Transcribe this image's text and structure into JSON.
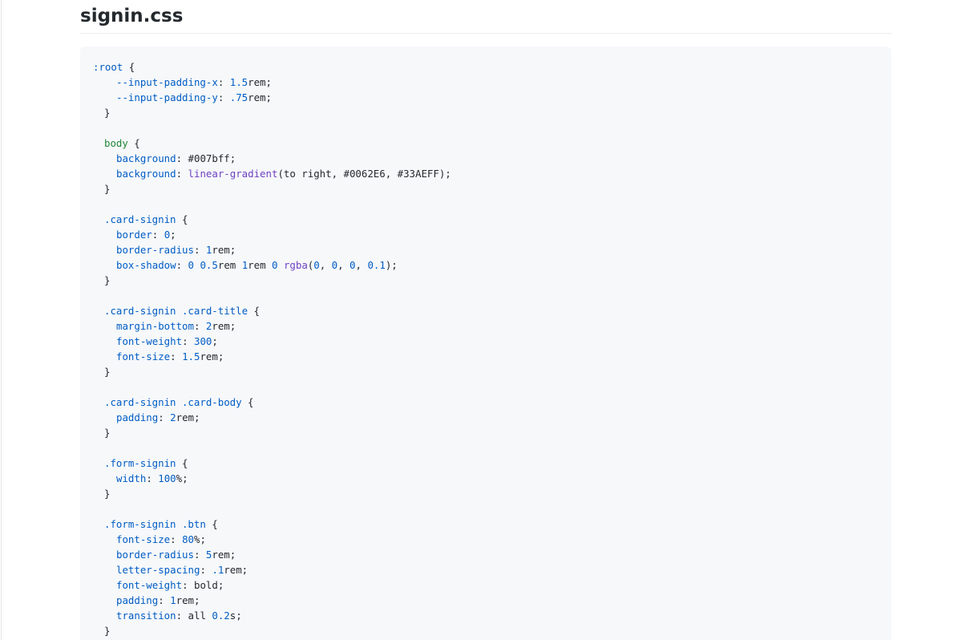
{
  "file": {
    "title": "signin.css"
  },
  "code_lines": [
    {
      "indent": 0,
      "tokens": [
        {
          "t": ":root",
          "c": "cls"
        },
        {
          "t": " {",
          "c": "plain"
        }
      ]
    },
    {
      "indent": 4,
      "tokens": [
        {
          "t": "--input-padding-x",
          "c": "prop"
        },
        {
          "t": ": ",
          "c": "plain"
        },
        {
          "t": "1.5",
          "c": "num"
        },
        {
          "t": "rem;",
          "c": "plain"
        }
      ]
    },
    {
      "indent": 4,
      "tokens": [
        {
          "t": "--input-padding-y",
          "c": "prop"
        },
        {
          "t": ": ",
          "c": "plain"
        },
        {
          "t": ".75",
          "c": "num"
        },
        {
          "t": "rem;",
          "c": "plain"
        }
      ]
    },
    {
      "indent": 2,
      "tokens": [
        {
          "t": "}",
          "c": "plain"
        }
      ]
    },
    {
      "indent": 0,
      "tokens": []
    },
    {
      "indent": 2,
      "tokens": [
        {
          "t": "body",
          "c": "sel"
        },
        {
          "t": " {",
          "c": "plain"
        }
      ]
    },
    {
      "indent": 4,
      "tokens": [
        {
          "t": "background",
          "c": "prop"
        },
        {
          "t": ": #007bff;",
          "c": "plain"
        }
      ]
    },
    {
      "indent": 4,
      "tokens": [
        {
          "t": "background",
          "c": "prop"
        },
        {
          "t": ": ",
          "c": "plain"
        },
        {
          "t": "linear-gradient",
          "c": "fn"
        },
        {
          "t": "(to right, #0062E6, #33AEFF);",
          "c": "plain"
        }
      ]
    },
    {
      "indent": 2,
      "tokens": [
        {
          "t": "}",
          "c": "plain"
        }
      ]
    },
    {
      "indent": 0,
      "tokens": []
    },
    {
      "indent": 2,
      "tokens": [
        {
          "t": ".card-signin",
          "c": "cls"
        },
        {
          "t": " {",
          "c": "plain"
        }
      ]
    },
    {
      "indent": 4,
      "tokens": [
        {
          "t": "border",
          "c": "prop"
        },
        {
          "t": ": ",
          "c": "plain"
        },
        {
          "t": "0",
          "c": "num"
        },
        {
          "t": ";",
          "c": "plain"
        }
      ]
    },
    {
      "indent": 4,
      "tokens": [
        {
          "t": "border-radius",
          "c": "prop"
        },
        {
          "t": ": ",
          "c": "plain"
        },
        {
          "t": "1",
          "c": "num"
        },
        {
          "t": "rem;",
          "c": "plain"
        }
      ]
    },
    {
      "indent": 4,
      "tokens": [
        {
          "t": "box-shadow",
          "c": "prop"
        },
        {
          "t": ": ",
          "c": "plain"
        },
        {
          "t": "0",
          "c": "num"
        },
        {
          "t": " ",
          "c": "plain"
        },
        {
          "t": "0.5",
          "c": "num"
        },
        {
          "t": "rem ",
          "c": "plain"
        },
        {
          "t": "1",
          "c": "num"
        },
        {
          "t": "rem ",
          "c": "plain"
        },
        {
          "t": "0",
          "c": "num"
        },
        {
          "t": " ",
          "c": "plain"
        },
        {
          "t": "rgba",
          "c": "fn"
        },
        {
          "t": "(",
          "c": "plain"
        },
        {
          "t": "0",
          "c": "num"
        },
        {
          "t": ", ",
          "c": "plain"
        },
        {
          "t": "0",
          "c": "num"
        },
        {
          "t": ", ",
          "c": "plain"
        },
        {
          "t": "0",
          "c": "num"
        },
        {
          "t": ", ",
          "c": "plain"
        },
        {
          "t": "0.1",
          "c": "num"
        },
        {
          "t": ");",
          "c": "plain"
        }
      ]
    },
    {
      "indent": 2,
      "tokens": [
        {
          "t": "}",
          "c": "plain"
        }
      ]
    },
    {
      "indent": 0,
      "tokens": []
    },
    {
      "indent": 2,
      "tokens": [
        {
          "t": ".card-signin .card-title",
          "c": "cls"
        },
        {
          "t": " {",
          "c": "plain"
        }
      ]
    },
    {
      "indent": 4,
      "tokens": [
        {
          "t": "margin-bottom",
          "c": "prop"
        },
        {
          "t": ": ",
          "c": "plain"
        },
        {
          "t": "2",
          "c": "num"
        },
        {
          "t": "rem;",
          "c": "plain"
        }
      ]
    },
    {
      "indent": 4,
      "tokens": [
        {
          "t": "font-weight",
          "c": "prop"
        },
        {
          "t": ": ",
          "c": "plain"
        },
        {
          "t": "300",
          "c": "num"
        },
        {
          "t": ";",
          "c": "plain"
        }
      ]
    },
    {
      "indent": 4,
      "tokens": [
        {
          "t": "font-size",
          "c": "prop"
        },
        {
          "t": ": ",
          "c": "plain"
        },
        {
          "t": "1.5",
          "c": "num"
        },
        {
          "t": "rem;",
          "c": "plain"
        }
      ]
    },
    {
      "indent": 2,
      "tokens": [
        {
          "t": "}",
          "c": "plain"
        }
      ]
    },
    {
      "indent": 0,
      "tokens": []
    },
    {
      "indent": 2,
      "tokens": [
        {
          "t": ".card-signin .card-body",
          "c": "cls"
        },
        {
          "t": " {",
          "c": "plain"
        }
      ]
    },
    {
      "indent": 4,
      "tokens": [
        {
          "t": "padding",
          "c": "prop"
        },
        {
          "t": ": ",
          "c": "plain"
        },
        {
          "t": "2",
          "c": "num"
        },
        {
          "t": "rem;",
          "c": "plain"
        }
      ]
    },
    {
      "indent": 2,
      "tokens": [
        {
          "t": "}",
          "c": "plain"
        }
      ]
    },
    {
      "indent": 0,
      "tokens": []
    },
    {
      "indent": 2,
      "tokens": [
        {
          "t": ".form-signin",
          "c": "cls"
        },
        {
          "t": " {",
          "c": "plain"
        }
      ]
    },
    {
      "indent": 4,
      "tokens": [
        {
          "t": "width",
          "c": "prop"
        },
        {
          "t": ": ",
          "c": "plain"
        },
        {
          "t": "100",
          "c": "num"
        },
        {
          "t": "%;",
          "c": "plain"
        }
      ]
    },
    {
      "indent": 2,
      "tokens": [
        {
          "t": "}",
          "c": "plain"
        }
      ]
    },
    {
      "indent": 0,
      "tokens": []
    },
    {
      "indent": 2,
      "tokens": [
        {
          "t": ".form-signin .btn",
          "c": "cls"
        },
        {
          "t": " {",
          "c": "plain"
        }
      ]
    },
    {
      "indent": 4,
      "tokens": [
        {
          "t": "font-size",
          "c": "prop"
        },
        {
          "t": ": ",
          "c": "plain"
        },
        {
          "t": "80",
          "c": "num"
        },
        {
          "t": "%;",
          "c": "plain"
        }
      ]
    },
    {
      "indent": 4,
      "tokens": [
        {
          "t": "border-radius",
          "c": "prop"
        },
        {
          "t": ": ",
          "c": "plain"
        },
        {
          "t": "5",
          "c": "num"
        },
        {
          "t": "rem;",
          "c": "plain"
        }
      ]
    },
    {
      "indent": 4,
      "tokens": [
        {
          "t": "letter-spacing",
          "c": "prop"
        },
        {
          "t": ": ",
          "c": "plain"
        },
        {
          "t": ".1",
          "c": "num"
        },
        {
          "t": "rem;",
          "c": "plain"
        }
      ]
    },
    {
      "indent": 4,
      "tokens": [
        {
          "t": "font-weight",
          "c": "prop"
        },
        {
          "t": ": bold;",
          "c": "plain"
        }
      ]
    },
    {
      "indent": 4,
      "tokens": [
        {
          "t": "padding",
          "c": "prop"
        },
        {
          "t": ": ",
          "c": "plain"
        },
        {
          "t": "1",
          "c": "num"
        },
        {
          "t": "rem;",
          "c": "plain"
        }
      ]
    },
    {
      "indent": 4,
      "tokens": [
        {
          "t": "transition",
          "c": "prop"
        },
        {
          "t": ": all ",
          "c": "plain"
        },
        {
          "t": "0.2",
          "c": "num"
        },
        {
          "t": "s;",
          "c": "plain"
        }
      ]
    },
    {
      "indent": 2,
      "tokens": [
        {
          "t": "}",
          "c": "plain"
        }
      ]
    }
  ],
  "colors": {
    "code_background": "#f6f8fa",
    "selector_tag": "#22863a",
    "selector_class": "#005cc5",
    "property": "#005cc5",
    "number": "#005cc5",
    "function": "#6f42c1",
    "text": "#24292e"
  }
}
